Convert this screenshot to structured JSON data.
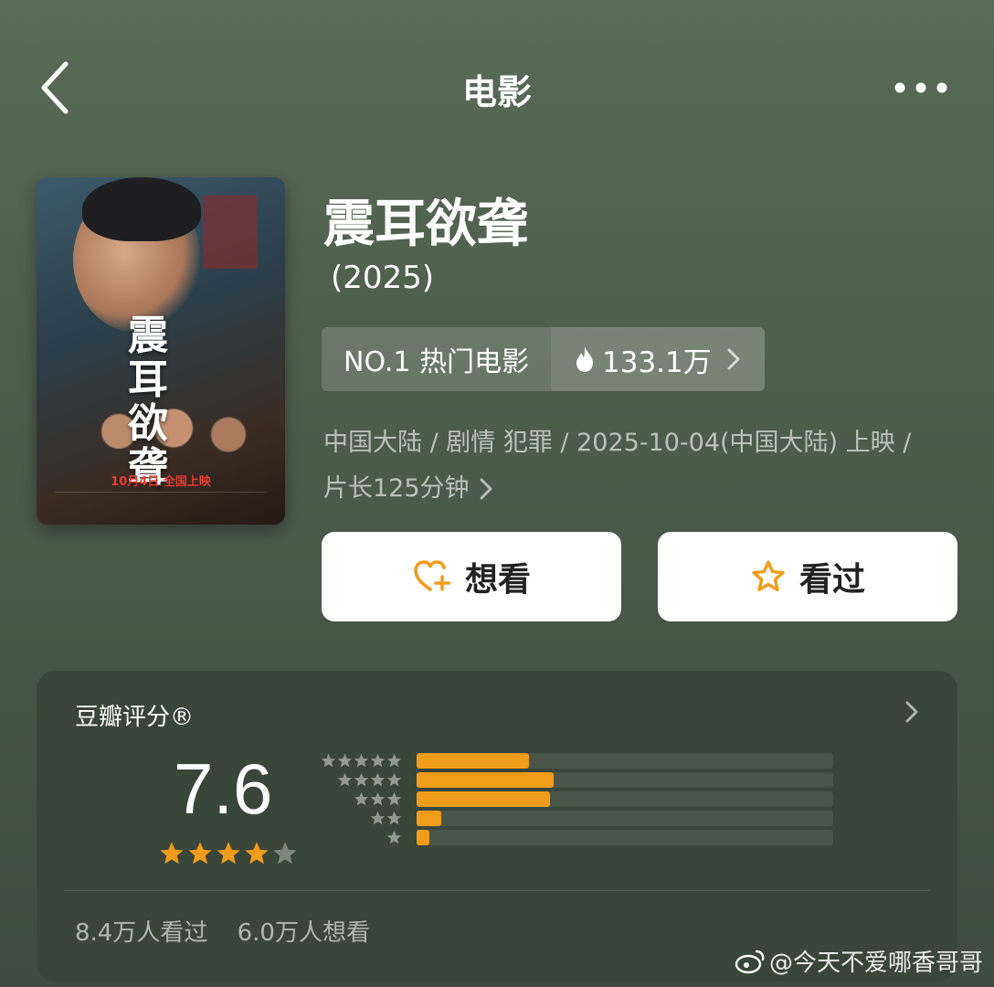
{
  "header": {
    "title": "电影"
  },
  "movie": {
    "title": "震耳欲聋",
    "year": "(2025)",
    "poster": {
      "title_text": "震耳欲聋",
      "date_text": "10月4日 全国上映"
    },
    "rank": {
      "label": "NO.1 热门电影",
      "heat": "133.1万"
    },
    "meta_line1": "中国大陆 / 剧情 犯罪 / 2025-10-04(中国大陆) 上映 /",
    "meta_line2": "片长125分钟"
  },
  "actions": {
    "want_label": "想看",
    "seen_label": "看过"
  },
  "rating": {
    "heading": "豆瓣评分®",
    "score": "7.6",
    "stars": 3.8,
    "distribution": [
      {
        "stars": 5,
        "fraction": 0.27
      },
      {
        "stars": 4,
        "fraction": 0.33
      },
      {
        "stars": 3,
        "fraction": 0.32
      },
      {
        "stars": 2,
        "fraction": 0.06
      },
      {
        "stars": 1,
        "fraction": 0.03
      }
    ],
    "seen_count": "8.4万人看过",
    "want_count": "6.0万人想看"
  },
  "watermark": "@今天不爱哪香哥哥",
  "colors": {
    "accent": "#f29c1b",
    "card": "#3a463a"
  },
  "icons": {
    "back": "chevron-left-icon",
    "more": "more-dots-icon",
    "fire": "fire-icon",
    "heart_plus": "heart-plus-icon",
    "star": "star-icon"
  }
}
